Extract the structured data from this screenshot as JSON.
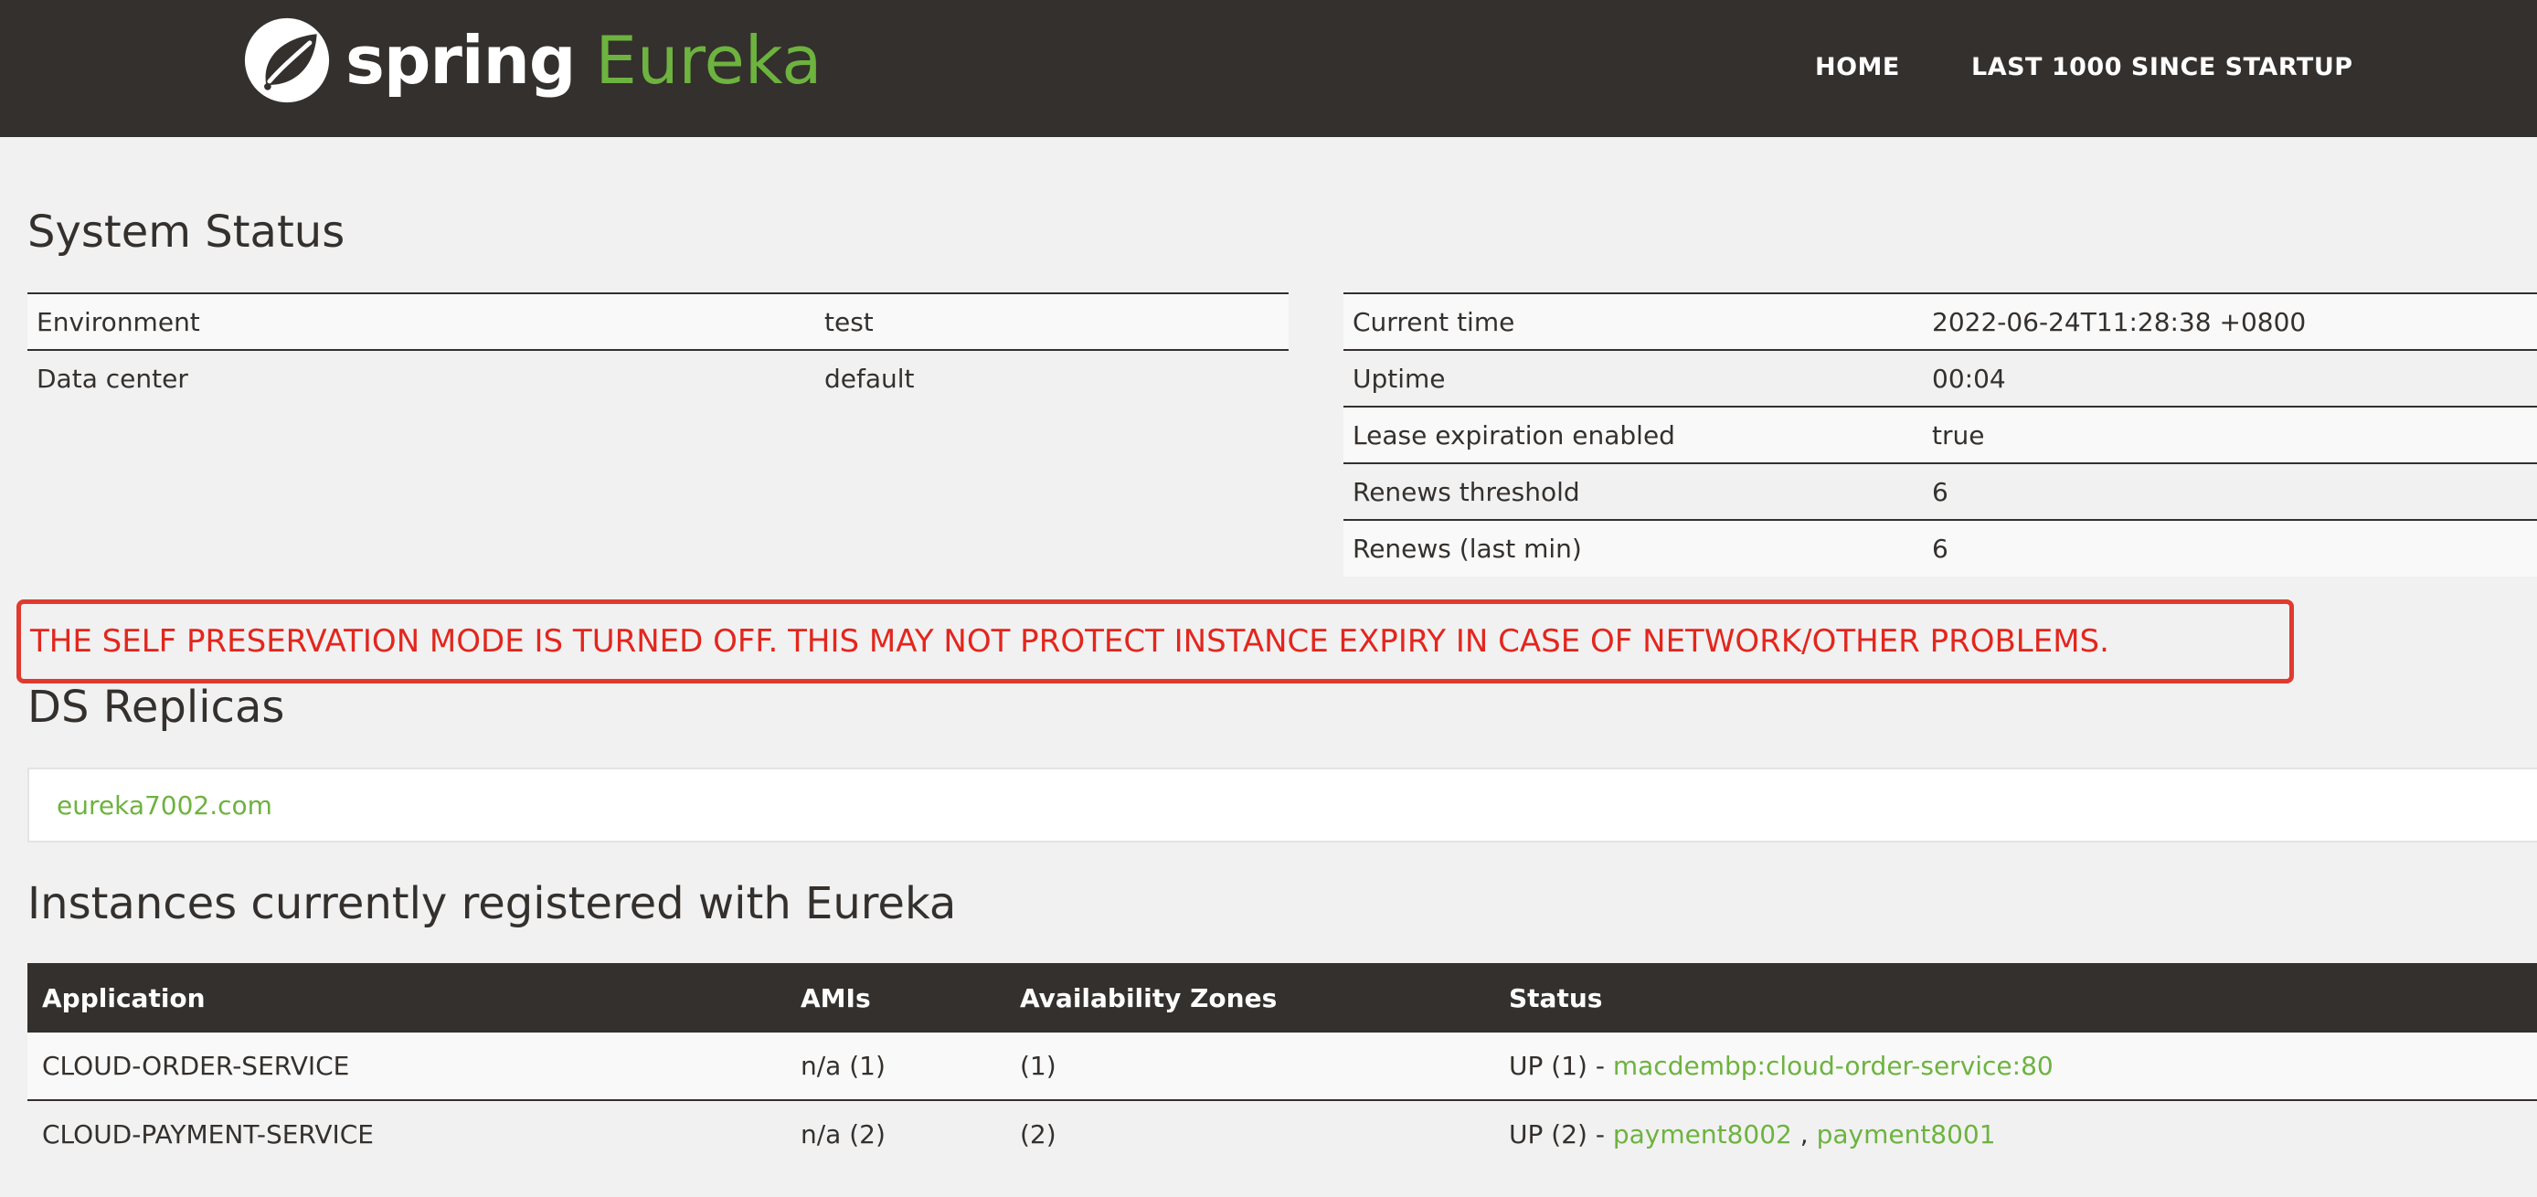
{
  "brand": {
    "spring": "spring",
    "eureka": "Eureka",
    "leaf_color": "#6db33f"
  },
  "nav": {
    "home": "HOME",
    "last1000": "LAST 1000 SINCE STARTUP"
  },
  "system_status": {
    "title": "System Status",
    "left": [
      {
        "key": "Environment",
        "value": "test"
      },
      {
        "key": "Data center",
        "value": "default"
      }
    ],
    "right": [
      {
        "key": "Current time",
        "value": "2022-06-24T11:28:38 +0800"
      },
      {
        "key": "Uptime",
        "value": "00:04"
      },
      {
        "key": "Lease expiration enabled",
        "value": "true"
      },
      {
        "key": "Renews threshold",
        "value": "6"
      },
      {
        "key": "Renews (last min)",
        "value": "6"
      }
    ]
  },
  "warning": {
    "text": "THE SELF PRESERVATION MODE IS TURNED OFF. THIS MAY NOT PROTECT INSTANCE EXPIRY IN CASE OF NETWORK/OTHER PROBLEMS.",
    "color": "#e3261d"
  },
  "replicas": {
    "title": "DS Replicas",
    "items": [
      "eureka7002.com"
    ]
  },
  "instances": {
    "title": "Instances currently registered with Eureka",
    "columns": [
      "Application",
      "AMIs",
      "Availability Zones",
      "Status"
    ],
    "rows": [
      {
        "application": "CLOUD-ORDER-SERVICE",
        "amis": "n/a (1)",
        "zones": "(1)",
        "status_prefix": "UP (1) - ",
        "links": [
          "macdembp:cloud-order-service:80"
        ],
        "separator": ""
      },
      {
        "application": "CLOUD-PAYMENT-SERVICE",
        "amis": "n/a (2)",
        "zones": "(2)",
        "status_prefix": "UP (2) - ",
        "links": [
          "payment8002",
          "payment8001"
        ],
        "separator": " , "
      }
    ]
  },
  "colors": {
    "header_bg": "#34302d",
    "accent_green": "#6db33f",
    "page_bg": "#f1f1f1"
  }
}
